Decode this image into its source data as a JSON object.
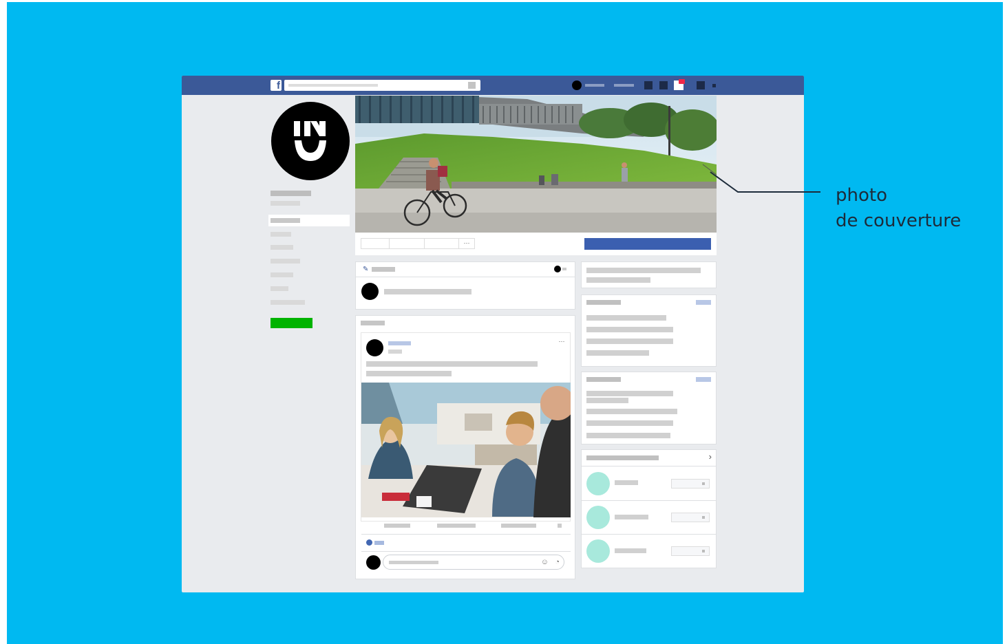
{
  "annotation": {
    "line1": "photo",
    "line2": "de couverture"
  },
  "topbar": {
    "logo_glyph": "f",
    "icons": [
      "facebook-logo-icon",
      "search-icon",
      "profile-avatar-icon",
      "friends-icon",
      "messages-icon",
      "notifications-icon",
      "help-icon",
      "menu-icon"
    ]
  },
  "cover_bar": {
    "more_label": "···"
  },
  "colors": {
    "background": "#00b9f1",
    "facebook_blue": "#3b5998",
    "cta_blue": "#3b5fb0",
    "green": "#00b300",
    "notification_red": "#f02849",
    "teal": "#a8e9dc"
  },
  "post": {
    "more_label": "···"
  },
  "suggestions": {
    "chevron": "›"
  }
}
